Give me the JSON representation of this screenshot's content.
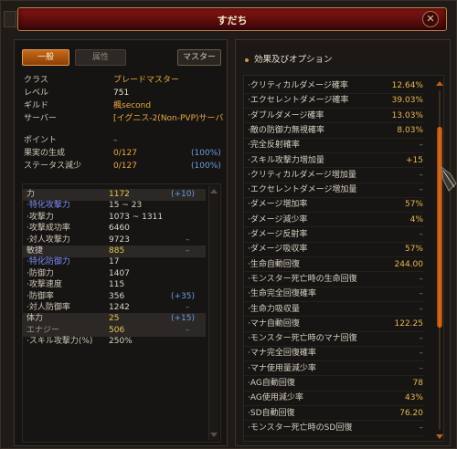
{
  "window": {
    "title": "すだち"
  },
  "tabs": {
    "general": "一般",
    "attribute": "属性",
    "master": "マスター"
  },
  "info": [
    {
      "label": "クラス",
      "value": "ブレードマスター"
    },
    {
      "label": "レベル",
      "value": "751"
    },
    {
      "label": "ギルド",
      "value": "楓second"
    },
    {
      "label": "サーバー",
      "value": "[イグニス-2(Non-PVP)サーバ"
    }
  ],
  "points": [
    {
      "label": "ポイント",
      "value": "–",
      "pct": ""
    },
    {
      "label": "果実の生成",
      "value": "0/127",
      "pct": "(100%)"
    },
    {
      "label": "ステータス減少",
      "value": "0/127",
      "pct": "(100%)"
    }
  ],
  "stats": [
    {
      "label": "力",
      "value": "1172",
      "bonus": "(+10)",
      "dash": "",
      "header": true,
      "style": ""
    },
    {
      "label": "·特化攻撃力",
      "value": "15 ~ 23",
      "bonus": "",
      "dash": "",
      "header": false,
      "style": "blue"
    },
    {
      "label": "·攻撃力",
      "value": "1073 ~ 1311",
      "bonus": "",
      "dash": "",
      "header": false,
      "style": ""
    },
    {
      "label": "·攻撃成功率",
      "value": "6460",
      "bonus": "",
      "dash": "",
      "header": false,
      "style": ""
    },
    {
      "label": "·対人攻撃力",
      "value": "9723",
      "bonus": "",
      "dash": "–",
      "header": false,
      "style": ""
    },
    {
      "label": "敏捷",
      "value": "885",
      "bonus": "",
      "dash": "–",
      "header": true,
      "style": ""
    },
    {
      "label": "·特化防御力",
      "value": "17",
      "bonus": "",
      "dash": "",
      "header": false,
      "style": "blue"
    },
    {
      "label": "·防御力",
      "value": "1407",
      "bonus": "",
      "dash": "",
      "header": false,
      "style": ""
    },
    {
      "label": "·攻撃速度",
      "value": "115",
      "bonus": "",
      "dash": "",
      "header": false,
      "style": ""
    },
    {
      "label": "·防御率",
      "value": "356",
      "bonus": "(+35)",
      "dash": "",
      "header": false,
      "style": ""
    },
    {
      "label": "·対人防御率",
      "value": "1242",
      "bonus": "",
      "dash": "–",
      "header": false,
      "style": ""
    },
    {
      "label": "体力",
      "value": "25",
      "bonus": "(+15)",
      "dash": "",
      "header": true,
      "style": ""
    },
    {
      "label": "エナジー",
      "value": "506",
      "bonus": "",
      "dash": "–",
      "header": true,
      "style": "grey"
    },
    {
      "label": "·スキル攻撃力(%)",
      "value": "250%",
      "bonus": "",
      "dash": "",
      "header": false,
      "style": ""
    }
  ],
  "options": {
    "heading": "効果及びオプション",
    "items": [
      {
        "label": "·クリティカルダメージ確率",
        "value": "12.64%"
      },
      {
        "label": "·エクセレントダメージ確率",
        "value": "39.03%"
      },
      {
        "label": "·ダブルダメージ確率",
        "value": "13.03%"
      },
      {
        "label": "·敵の防御力無視確率",
        "value": "8.03%"
      },
      {
        "label": "·完全反射確率",
        "value": "–"
      },
      {
        "label": "·スキル攻撃力増加量",
        "value": "+15"
      },
      {
        "label": "·クリティカルダメージ増加量",
        "value": "–"
      },
      {
        "label": "·エクセレントダメージ増加量",
        "value": "–"
      },
      {
        "label": "·ダメージ増加率",
        "value": "57%"
      },
      {
        "label": "·ダメージ減少率",
        "value": "4%"
      },
      {
        "label": "·ダメージ反射率",
        "value": "–"
      },
      {
        "label": "·ダメージ吸収率",
        "value": "57%"
      },
      {
        "label": "·生命自動回復",
        "value": "244.00"
      },
      {
        "label": "·モンスター死亡時の生命回復",
        "value": "–"
      },
      {
        "label": "·生命完全回復確率",
        "value": "–"
      },
      {
        "label": "·生命力吸収量",
        "value": "–"
      },
      {
        "label": "·マナ自動回復",
        "value": "122.25"
      },
      {
        "label": "·モンスター死亡時のマナ回復",
        "value": "–"
      },
      {
        "label": "·マナ完全回復確率",
        "value": "–"
      },
      {
        "label": "·マナ使用量減少率",
        "value": "–"
      },
      {
        "label": "·AG自動回復",
        "value": "78"
      },
      {
        "label": "·AG使用減少率",
        "value": "43%"
      },
      {
        "label": "·SD自動回復",
        "value": "76.20"
      },
      {
        "label": "·モンスター死亡時のSD回復",
        "value": "–"
      }
    ]
  }
}
